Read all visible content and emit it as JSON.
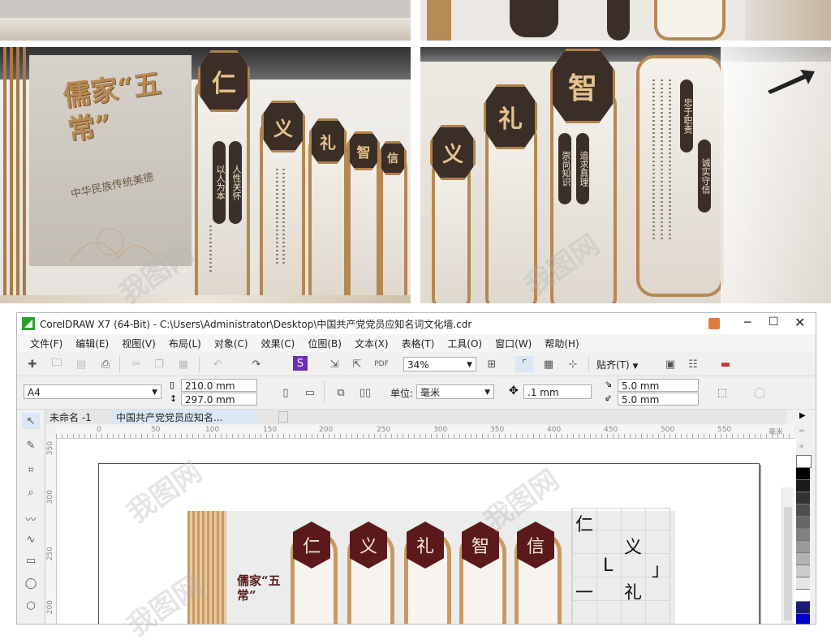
{
  "photos": {
    "top_left_signage": "儒家“五常”",
    "top_left_subtitle": "中华民族传统美德",
    "virtue_chars": [
      "仁",
      "义",
      "礼",
      "智",
      "信"
    ],
    "pill_texts_left": [
      "以人为本",
      "人性关怀"
    ],
    "pill_texts_right": [
      "忠于职责",
      "诚实守信"
    ],
    "pill_texts_mid": [
      "崇尚知识",
      "追求真理"
    ]
  },
  "app": {
    "window_title": "CorelDRAW X7 (64-Bit) - C:\\Users\\Administrator\\Desktop\\中国共产党党员应知名词文化墙.cdr",
    "menu": [
      "文件(F)",
      "编辑(E)",
      "视图(V)",
      "布局(L)",
      "对象(C)",
      "效果(C)",
      "位图(B)",
      "文本(X)",
      "表格(T)",
      "工具(O)",
      "窗口(W)",
      "帮助(H)"
    ],
    "toolbar": {
      "zoom": "34%",
      "snap_label": "贴齐(T)"
    },
    "property_bar": {
      "page_size": "A4",
      "width": "210.0 mm",
      "height": "297.0 mm",
      "units_label": "单位:",
      "units_value": "毫米",
      "nudge": ".1 mm",
      "dup_x": "5.0 mm",
      "dup_y": "5.0 mm"
    },
    "tabs": [
      "未命名 -1",
      "中国共产党党员应知名..."
    ],
    "ruler": {
      "labels": [
        "0",
        "50",
        "100",
        "150",
        "200",
        "250",
        "300",
        "350",
        "400",
        "450",
        "500",
        "550"
      ],
      "unit": "毫米",
      "v_labels": [
        "350",
        "300",
        "250",
        "200"
      ]
    },
    "document": {
      "title": "儒家“五常”",
      "virtue_chars": [
        "仁",
        "义",
        "礼",
        "智",
        "信"
      ],
      "grid_chars": [
        "仁",
        "义",
        "L",
        "」",
        "一",
        "礼"
      ]
    },
    "colors": {
      "maroon": "#5a1a1c",
      "gold": "#c79a61",
      "accent_green": "#2aa12f"
    }
  }
}
